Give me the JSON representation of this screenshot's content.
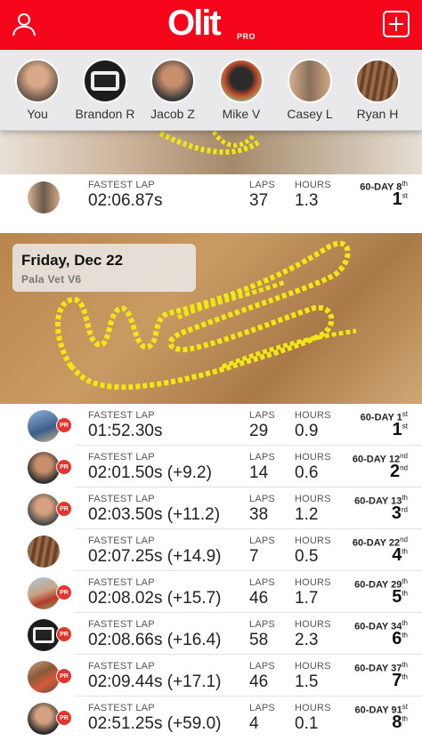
{
  "header": {
    "logo_text": "Olit",
    "logo_pro": "PRO",
    "colors": {
      "header_bg": "#f5061a",
      "pr_badge": "#e5342b",
      "track": "#f2e614"
    }
  },
  "friends": [
    {
      "name": "You",
      "avatar_icon": "user-avatar"
    },
    {
      "name": "Brandon R",
      "avatar_icon": "number-plate-327-avatar"
    },
    {
      "name": "Jacob Z",
      "avatar_icon": "user-avatar"
    },
    {
      "name": "Mike V",
      "avatar_icon": "helmet-avatar"
    },
    {
      "name": "Casey L",
      "avatar_icon": "user-avatar"
    },
    {
      "name": "Ryan H",
      "avatar_icon": "track-avatar"
    }
  ],
  "labels": {
    "fastest_lap": "FASTEST LAP",
    "laps": "LAPS",
    "hours": "HOURS"
  },
  "top_session": {
    "lap_time": "02:06.87s",
    "laps": "37",
    "hours": "1.3",
    "period": "60-DAY 8",
    "period_suffix": "th",
    "rank": "1",
    "rank_suffix": "st"
  },
  "day": {
    "title": "Friday, Dec 22",
    "track": "Pala Vet V6"
  },
  "sessions": [
    {
      "lap_time": "01:52.30s",
      "laps": "29",
      "hours": "0.9",
      "period": "60-DAY 1",
      "period_suffix": "st",
      "rank": "1",
      "rank_suffix": "st",
      "pr": "PR"
    },
    {
      "lap_time": "02:01.50s (+9.2)",
      "laps": "14",
      "hours": "0.6",
      "period": "60-DAY 12",
      "period_suffix": "nd",
      "rank": "2",
      "rank_suffix": "nd",
      "pr": "PR"
    },
    {
      "lap_time": "02:03.50s (+11.2)",
      "laps": "38",
      "hours": "1.2",
      "period": "60-DAY 13",
      "period_suffix": "th",
      "rank": "3",
      "rank_suffix": "rd",
      "pr": "PR"
    },
    {
      "lap_time": "02:07.25s (+14.9)",
      "laps": "7",
      "hours": "0.5",
      "period": "60-DAY 22",
      "period_suffix": "nd",
      "rank": "4",
      "rank_suffix": "th",
      "pr": ""
    },
    {
      "lap_time": "02:08.02s (+15.7)",
      "laps": "46",
      "hours": "1.7",
      "period": "60-DAY 29",
      "period_suffix": "th",
      "rank": "5",
      "rank_suffix": "th",
      "pr": "PR"
    },
    {
      "lap_time": "02:08.66s (+16.4)",
      "laps": "58",
      "hours": "2.3",
      "period": "60-DAY 34",
      "period_suffix": "th",
      "rank": "6",
      "rank_suffix": "th",
      "pr": "PR"
    },
    {
      "lap_time": "02:09.44s (+17.1)",
      "laps": "46",
      "hours": "1.5",
      "period": "60-DAY 37",
      "period_suffix": "th",
      "rank": "7",
      "rank_suffix": "th",
      "pr": "PR"
    },
    {
      "lap_time": "02:51.25s (+59.0)",
      "laps": "4",
      "hours": "0.1",
      "period": "60-DAY 91",
      "period_suffix": "st",
      "rank": "8",
      "rank_suffix": "th",
      "pr": "PR"
    }
  ]
}
